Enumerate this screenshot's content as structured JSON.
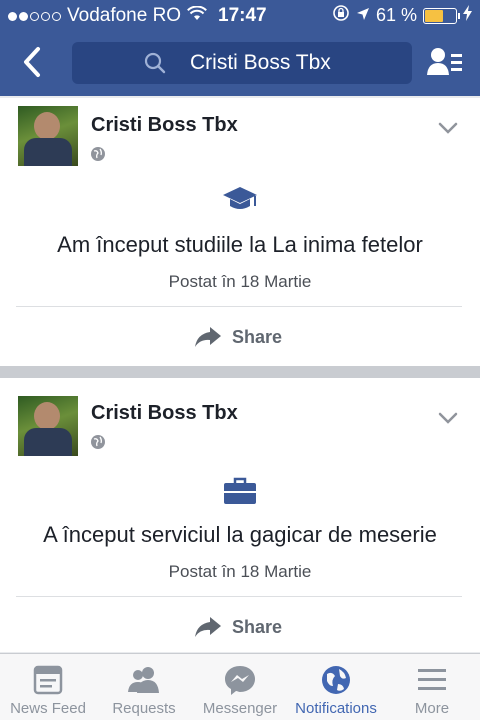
{
  "status_bar": {
    "carrier": "Vodafone RO",
    "time": "17:47",
    "battery_percent": "61 %",
    "battery_level": 0.61,
    "signal_bars_filled": 2,
    "signal_bars_total": 5
  },
  "search": {
    "query": "Cristi Boss Tbx"
  },
  "posts": [
    {
      "author": "Cristi Boss Tbx",
      "event_icon": "graduation-cap-icon",
      "event_text": "Am început studiile la La inima fetelor",
      "date": "Postat în 18 Martie",
      "share_label": "Share"
    },
    {
      "author": "Cristi Boss Tbx",
      "event_icon": "briefcase-icon",
      "event_text": "A început serviciul la gagicar de meserie",
      "date": "Postat în 18 Martie",
      "share_label": "Share"
    }
  ],
  "tabs": [
    {
      "label": "News Feed",
      "icon": "news-feed-icon",
      "active": false
    },
    {
      "label": "Requests",
      "icon": "friends-icon",
      "active": false
    },
    {
      "label": "Messenger",
      "icon": "messenger-icon",
      "active": false
    },
    {
      "label": "Notifications",
      "icon": "globe-icon",
      "active": true
    },
    {
      "label": "More",
      "icon": "menu-icon",
      "active": false
    }
  ],
  "colors": {
    "brand": "#3b5998",
    "accent": "#4267b2",
    "battery": "#f6c142"
  }
}
